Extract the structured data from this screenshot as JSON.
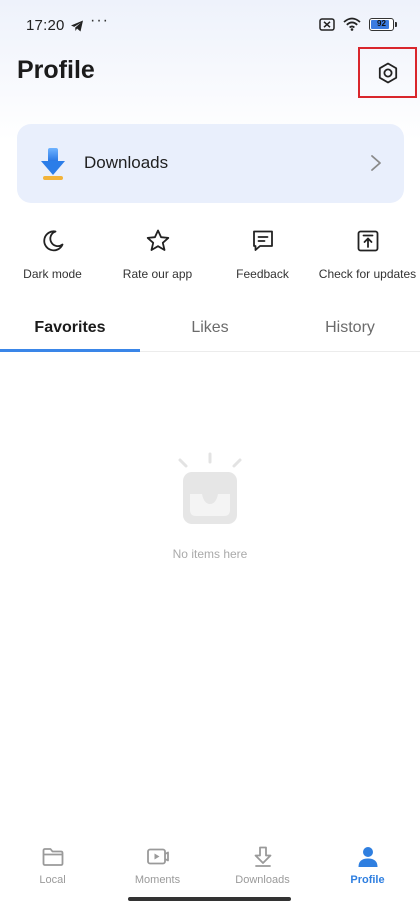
{
  "status_bar": {
    "time": "17:20",
    "dots": "···",
    "battery_level": "92",
    "battery_fraction": 0.92
  },
  "header": {
    "title": "Profile",
    "settings_icon": "gear-icon"
  },
  "downloads_card": {
    "label": "Downloads",
    "icon": "download-arrow-icon"
  },
  "quick_actions": [
    {
      "label": "Dark mode",
      "icon": "moon-icon"
    },
    {
      "label": "Rate our app",
      "icon": "star-icon"
    },
    {
      "label": "Feedback",
      "icon": "feedback-icon"
    },
    {
      "label": "Check for updates",
      "icon": "update-icon"
    }
  ],
  "tabs": [
    {
      "label": "Favorites",
      "active": true
    },
    {
      "label": "Likes",
      "active": false
    },
    {
      "label": "History",
      "active": false
    }
  ],
  "empty_state": {
    "text": "No items here",
    "icon": "empty-tv-icon"
  },
  "bottom_nav": [
    {
      "label": "Local",
      "icon": "folder-icon",
      "active": false
    },
    {
      "label": "Moments",
      "icon": "video-icon",
      "active": false
    },
    {
      "label": "Downloads",
      "icon": "download-icon",
      "active": false
    },
    {
      "label": "Profile",
      "icon": "person-icon",
      "active": true
    }
  ],
  "colors": {
    "accent": "#2f7fe0",
    "tab_indicator": "#3a86e8",
    "card_background": "#e9effc",
    "highlight_box": "#d9262c"
  }
}
